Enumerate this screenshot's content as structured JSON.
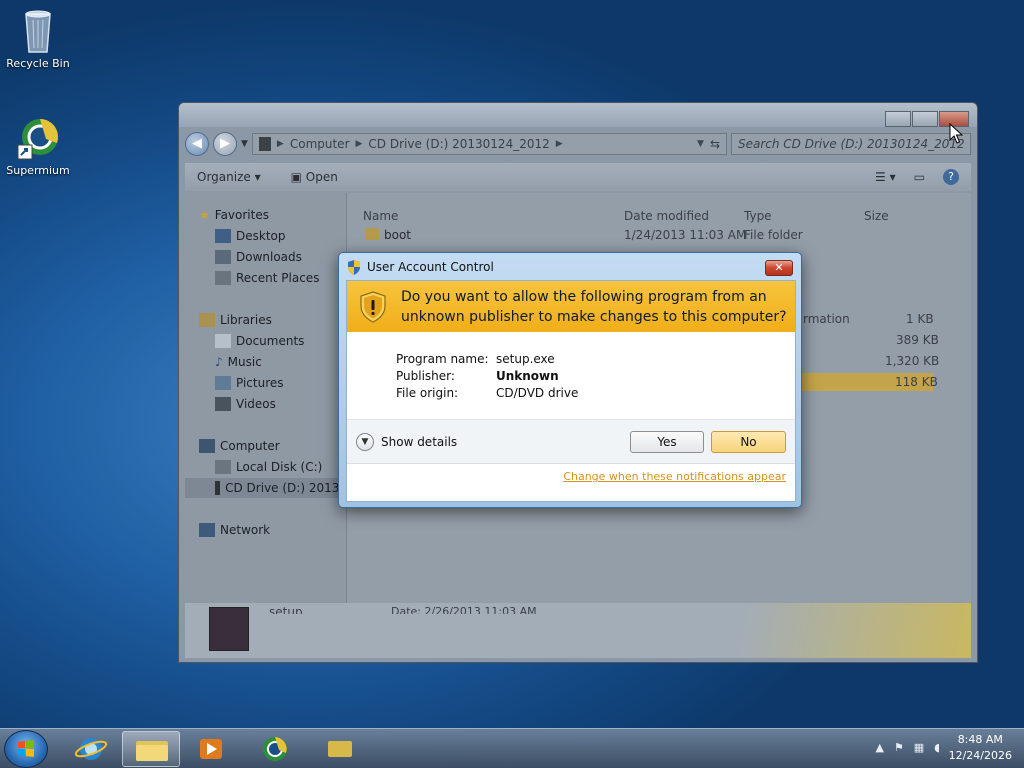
{
  "desktop": {
    "icons": [
      {
        "label": "Recycle Bin"
      },
      {
        "label": "Supermium"
      }
    ]
  },
  "explorer": {
    "breadcrumb": [
      "Computer",
      "CD Drive (D:) 20130124_2012"
    ],
    "search_placeholder": "Search CD Drive (D:) 20130124_2012",
    "toolbar": {
      "organize": "Organize",
      "open": "Open"
    },
    "nav": {
      "favorites": "Favorites",
      "desktop": "Desktop",
      "downloads": "Downloads",
      "recent_places": "Recent Places",
      "libraries": "Libraries",
      "documents": "Documents",
      "music": "Music",
      "pictures": "Pictures",
      "videos": "Videos",
      "computer": "Computer",
      "local_disk": "Local Disk (C:)",
      "cd_drive": "CD Drive (D:) 20130",
      "network": "Network"
    },
    "columns": {
      "name": "Name",
      "date": "Date modified",
      "type": "Type",
      "size": "Size"
    },
    "rows": [
      {
        "name": "boot",
        "date": "1/24/2013 11:03 AM",
        "type": "File folder",
        "size": ""
      }
    ],
    "partial": {
      "type_fragment": "rmation",
      "sizes": [
        "1 KB",
        "389 KB",
        "1,320 KB",
        "118 KB"
      ]
    },
    "details": {
      "name": "setup",
      "date": "Date: 2/26/2013 11:03 AM"
    }
  },
  "uac": {
    "title": "User Account Control",
    "question": "Do you want to allow the following program from an unknown publisher to make changes to this computer?",
    "fields": [
      {
        "label": "Program name:",
        "value": "setup.exe",
        "bold": false
      },
      {
        "label": "Publisher:",
        "value": "Unknown",
        "bold": true
      },
      {
        "label": "File origin:",
        "value": "CD/DVD drive",
        "bold": false
      }
    ],
    "show_details": "Show details",
    "yes": "Yes",
    "no": "No",
    "link": "Change when these notifications appear",
    "close_glyph": "✕"
  },
  "taskbar": {
    "time": "8:48 AM",
    "date": "12/24/2026"
  },
  "colors": {
    "banner": "#f0ae1a",
    "link": "#d3931f",
    "desktop": "#1f5fa3"
  }
}
